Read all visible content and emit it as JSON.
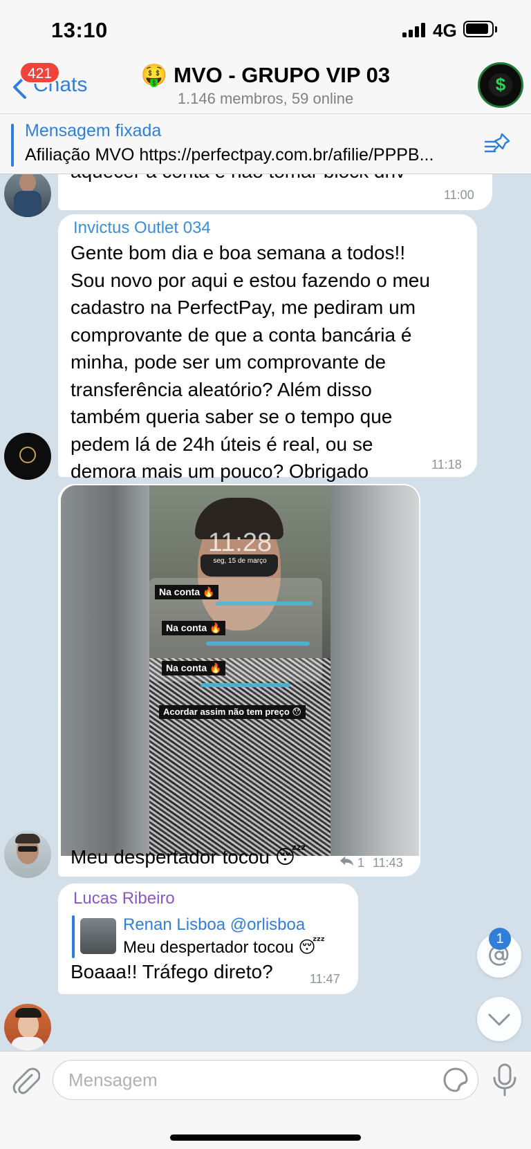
{
  "status_bar": {
    "time": "13:10",
    "network": "4G",
    "signal_bars": 4,
    "battery_level": 0.85
  },
  "header": {
    "back_label": "Chats",
    "unread_count": "421",
    "title_emoji": "🤑",
    "title": "MVO - GRUPO VIP 03",
    "subtitle": "1.146 membros, 59 online"
  },
  "pinned": {
    "title": "Mensagem fixada",
    "text": "Afiliação MVO https://perfectpay.com.br/afilie/PPPB..."
  },
  "messages": [
    {
      "text": "aquecer a conta e não tomar block dnv",
      "time": "11:00"
    },
    {
      "sender": "Invictus Outlet 034",
      "sender_color": "#3a8fd9",
      "text": "Gente bom dia e boa semana a todos!!\nSou novo por aqui e estou fazendo o meu\ncadastro na PerfectPay, me pediram um\ncomprovante de que a conta bancária é\nminha, pode ser um comprovante de\ntransferência aleatório? Além disso\ntambém queria saber se o tempo que\npedem lá de 24h úteis é real, ou se\ndemora mais um pouco? Obrigado",
      "time": "11:18"
    },
    {
      "image": {
        "lock_time": "11:28",
        "lock_date": "seg, 15 de março",
        "stickers": [
          "Na conta 🔥",
          "Na conta 🔥",
          "Na conta 🔥",
          "Acordar assim não tem preço 😯"
        ]
      },
      "text": "Meu despertador tocou 😴",
      "reply_count": "1",
      "time": "11:43"
    },
    {
      "sender": "Lucas Ribeiro",
      "sender_color": "#8a57c9",
      "reply": {
        "author": "Renan Lisboa @orlisboa",
        "text": "Meu despertador tocou 😴"
      },
      "text": "Boaaa!! Tráfego direto?",
      "time": "11:47"
    }
  ],
  "floating": {
    "mention_count": "1"
  },
  "input": {
    "placeholder": "Mensagem"
  },
  "colors": {
    "accent": "#2f7fd8",
    "badge": "#f0433b",
    "chat_background": "#d3dfe9"
  }
}
